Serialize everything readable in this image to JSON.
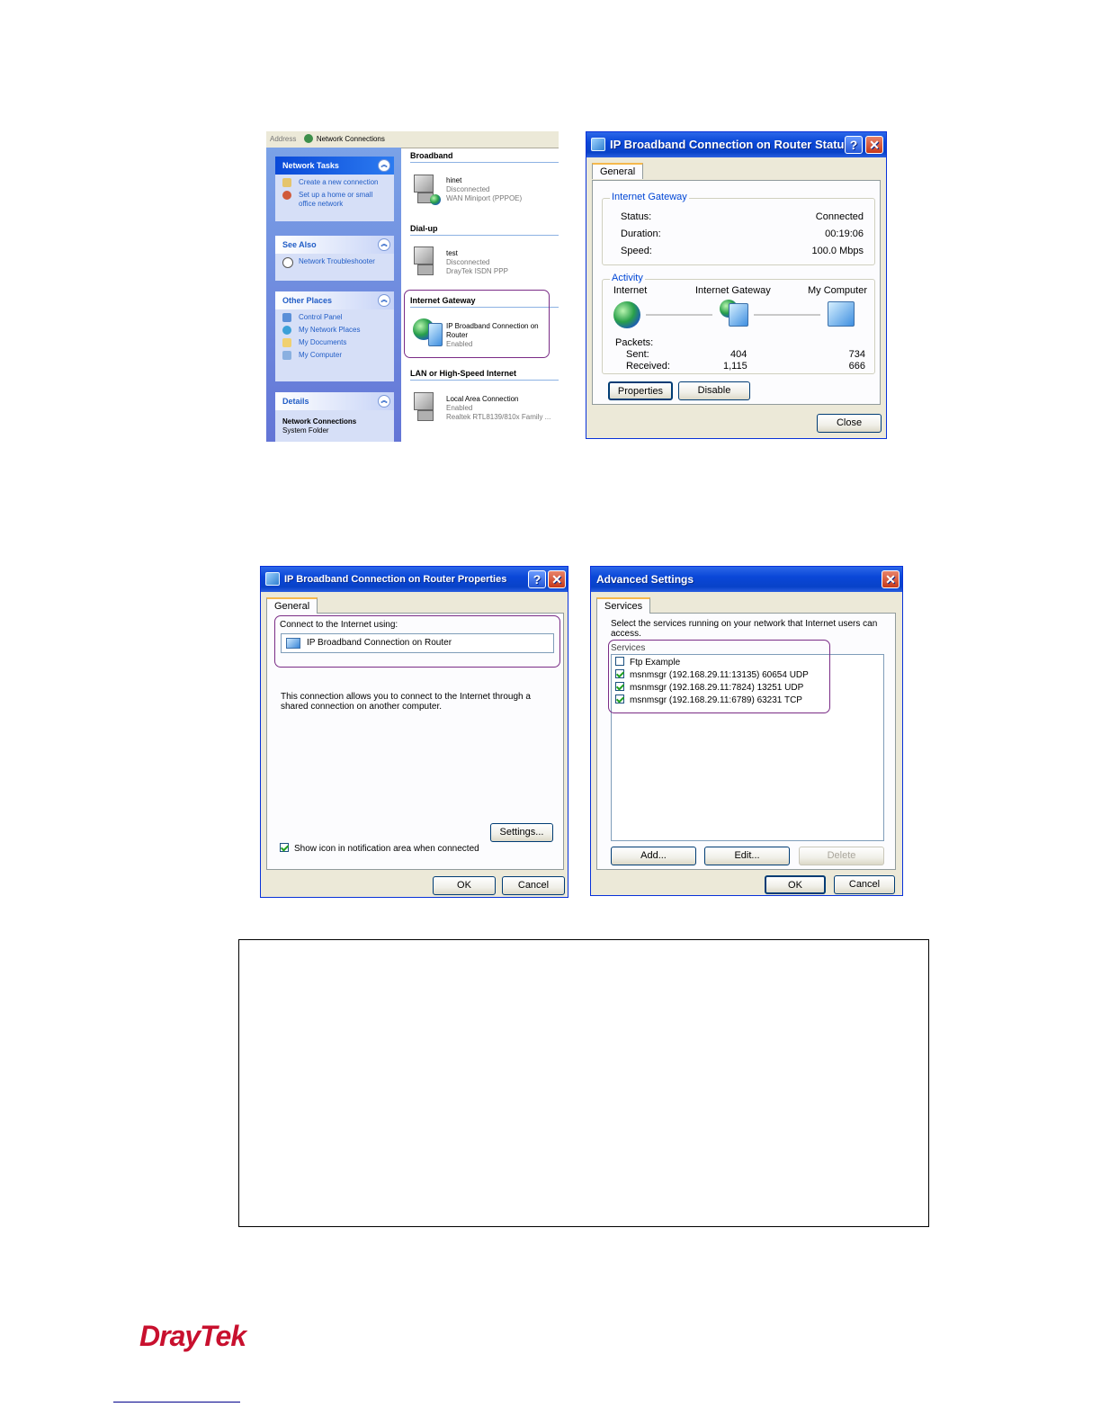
{
  "explorer": {
    "address_label": "Address",
    "address_value": "Network Connections",
    "network_tasks": {
      "title": "Network Tasks",
      "items": [
        "Create a new connection",
        "Set up a home or small",
        "office network"
      ]
    },
    "see_also": {
      "title": "See Also",
      "items": [
        "Network Troubleshooter"
      ]
    },
    "other_places": {
      "title": "Other Places",
      "items": [
        "Control Panel",
        "My Network Places",
        "My Documents",
        "My Computer"
      ]
    },
    "details": {
      "title": "Details",
      "name": "Network Connections",
      "type": "System Folder"
    },
    "categories": {
      "broadband": "Broadband",
      "dialup": "Dial-up",
      "gateway": "Internet Gateway",
      "lan": "LAN or High-Speed Internet"
    },
    "connections": {
      "hinet": {
        "name": "hinet",
        "status": "Disconnected",
        "device": "WAN Miniport (PPPOE)"
      },
      "test": {
        "name": "test",
        "status": "Disconnected",
        "device": "DrayTek ISDN PPP"
      },
      "ipbroad": {
        "name1": "IP Broadband Connection on",
        "name2": "Router",
        "status": "Enabled"
      },
      "lan": {
        "name": "Local Area Connection",
        "status": "Enabled",
        "device": "Realtek RTL8139/810x Family ..."
      }
    }
  },
  "status_dialog": {
    "title": "IP Broadband Connection on Router Status",
    "help": "?",
    "close_x": "✕",
    "tab": "General",
    "gateway_group": "Internet Gateway",
    "status_label": "Status:",
    "status_value": "Connected",
    "duration_label": "Duration:",
    "duration_value": "00:19:06",
    "speed_label": "Speed:",
    "speed_value": "100.0 Mbps",
    "activity_group": "Activity",
    "col_internet": "Internet",
    "col_gateway": "Internet Gateway",
    "col_computer": "My Computer",
    "packets_label": "Packets:",
    "sent_label": "Sent:",
    "sent_gateway": "404",
    "sent_computer": "734",
    "received_label": "Received:",
    "received_gateway": "1,115",
    "received_computer": "666",
    "properties_button": "Properties",
    "disable_button": "Disable",
    "close_button": "Close"
  },
  "properties_dialog": {
    "title": "IP Broadband Connection on Router Properties",
    "help": "?",
    "close_x": "✕",
    "tab": "General",
    "connect_label": "Connect to the Internet using:",
    "connection_name": "IP Broadband Connection on Router",
    "description_line1": "This connection allows you to connect to the Internet through a",
    "description_line2": "shared connection on another computer.",
    "settings_button": "Settings...",
    "show_icon_label": "Show icon in notification area when connected",
    "ok_button": "OK",
    "cancel_button": "Cancel"
  },
  "advanced_dialog": {
    "title": "Advanced Settings",
    "close_x": "✕",
    "tab": "Services",
    "intro_line1": "Select the services running on your network that Internet users can",
    "intro_line2": "access.",
    "services_label": "Services",
    "services": [
      {
        "label": "Ftp Example",
        "checked": false
      },
      {
        "label": "msnmsgr (192.168.29.11:13135) 60654 UDP",
        "checked": true
      },
      {
        "label": "msnmsgr (192.168.29.11:7824) 13251 UDP",
        "checked": true
      },
      {
        "label": "msnmsgr (192.168.29.11:6789) 63231 TCP",
        "checked": true
      }
    ],
    "add_button": "Add...",
    "edit_button": "Edit...",
    "delete_button": "Delete",
    "ok_button": "OK",
    "cancel_button": "Cancel"
  },
  "footer": {
    "logo_dray": "Dray",
    "logo_tek": "Tek"
  },
  "colors": {
    "xp_blue": "#0a47d8",
    "highlight": "#7a2c86",
    "brand_red": "#c8102e"
  }
}
